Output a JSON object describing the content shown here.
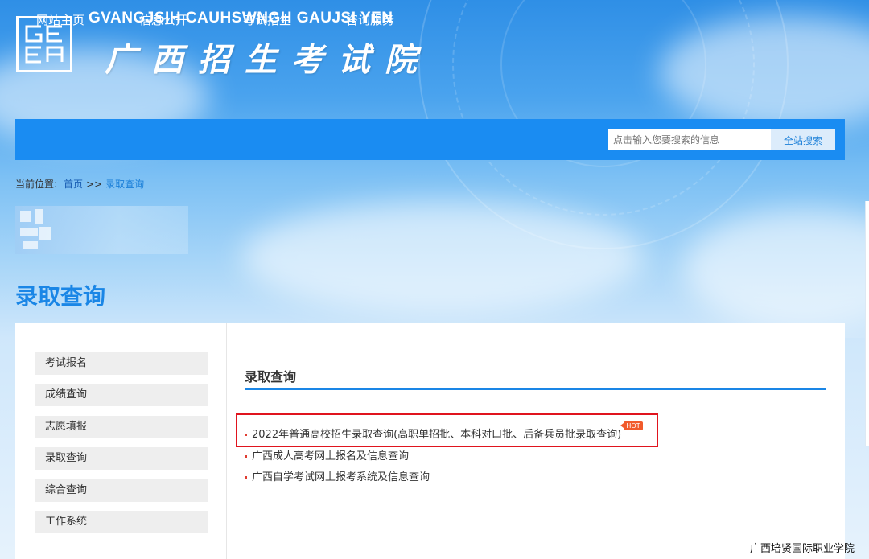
{
  "header": {
    "logo_icon": "geea-logo-icon",
    "title_en": "GVANGJSIH CAUHSWNGH GAUJSI YEN",
    "title_cn": "广西招生考试院"
  },
  "nav": {
    "items": [
      {
        "label": "网站主页"
      },
      {
        "label": "信息公开"
      },
      {
        "label": "考试招生"
      },
      {
        "label": "咨询服务"
      }
    ],
    "search_placeholder": "点击输入您要搜索的信息",
    "search_button": "全站搜索"
  },
  "breadcrumb": {
    "prefix": "当前位置:",
    "home": "首页",
    "separator": ">>",
    "current": "录取查询"
  },
  "page_title": "录取查询",
  "sidebar": {
    "items": [
      {
        "label": "考试报名"
      },
      {
        "label": "成绩查询"
      },
      {
        "label": "志愿填报"
      },
      {
        "label": "录取查询"
      },
      {
        "label": "综合查询"
      },
      {
        "label": "工作系统"
      }
    ]
  },
  "main": {
    "section_title": "录取查询",
    "links": [
      {
        "label": "2022年普通高校招生录取查询(高职单招批、本科对口批、后备兵员批录取查询)"
      },
      {
        "label": "广西成人高考网上报名及信息查询"
      },
      {
        "label": "广西自学考试网上报考系统及信息查询"
      }
    ],
    "hot_badge": "HOT"
  },
  "watermark": "广西培贤国际职业学院",
  "colors": {
    "nav_bg": "#1a8cf2",
    "accent": "#1a86e6",
    "highlight_border": "#e0141e",
    "hot_badge": "#f15a2b"
  }
}
